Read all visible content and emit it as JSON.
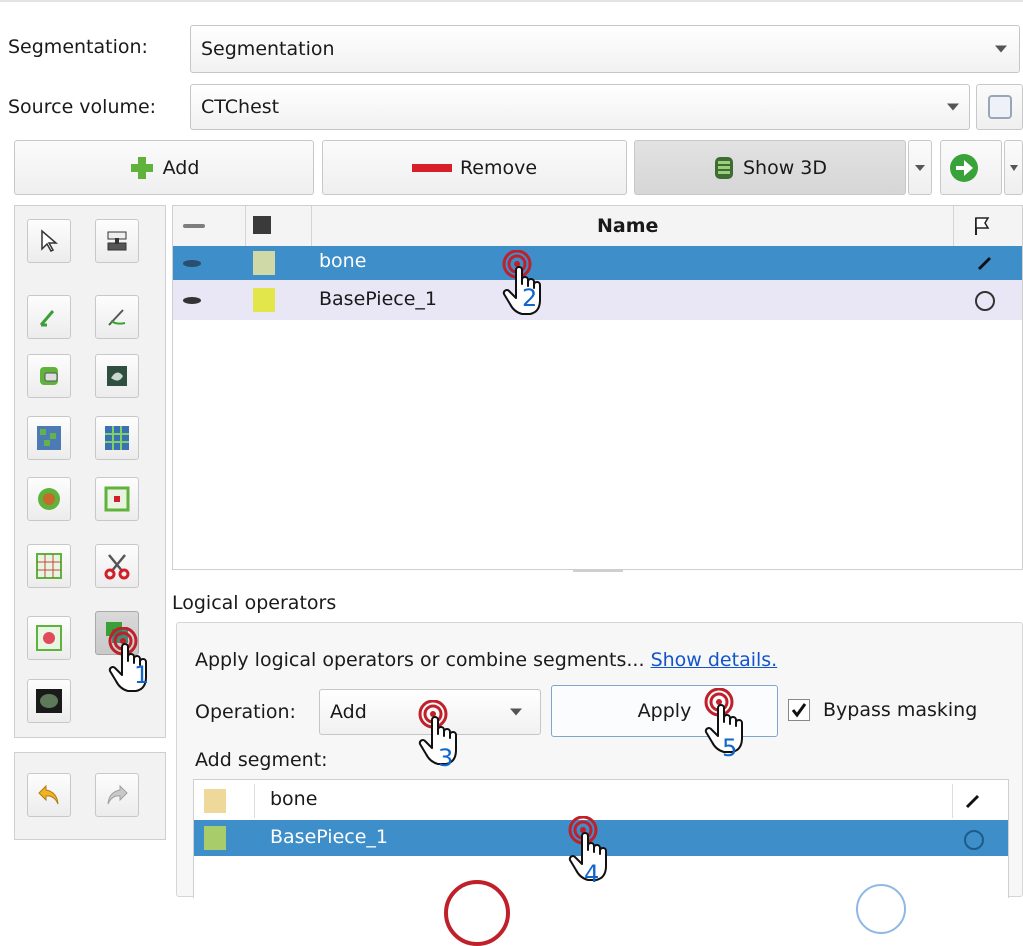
{
  "segmentation": {
    "label": "Segmentation:",
    "value": "Segmentation"
  },
  "source_volume": {
    "label": "Source volume:",
    "value": "CTChest"
  },
  "toolbar": {
    "add_label": "Add",
    "remove_label": "Remove",
    "show3d_label": "Show 3D"
  },
  "segments_table": {
    "headers": {
      "name": "Name"
    },
    "rows": [
      {
        "name": "bone",
        "color": "#cfd9a8",
        "status": "edit"
      },
      {
        "name": "BasePiece_1",
        "color": "#e3e64a",
        "status": "circle"
      }
    ]
  },
  "logical_operators": {
    "title": "Logical operators",
    "description": "Apply logical operators or combine segments...",
    "details_link": "Show details.",
    "operation_label": "Operation:",
    "operation_value": "Add",
    "apply_label": "Apply",
    "bypass_label": "Bypass masking",
    "bypass_checked": true,
    "add_segment_label": "Add segment:",
    "segments": [
      {
        "name": "bone",
        "color": "#efd99a"
      },
      {
        "name": "BasePiece_1",
        "color": "#a8cc6a"
      }
    ]
  },
  "annotations": [
    "1",
    "2",
    "3",
    "4",
    "5"
  ],
  "colors": {
    "selection": "#3d8ec9",
    "alt_row": "#e9e7f6",
    "annotation_ring": "#c0202a",
    "annotation_number": "#1166cc"
  }
}
